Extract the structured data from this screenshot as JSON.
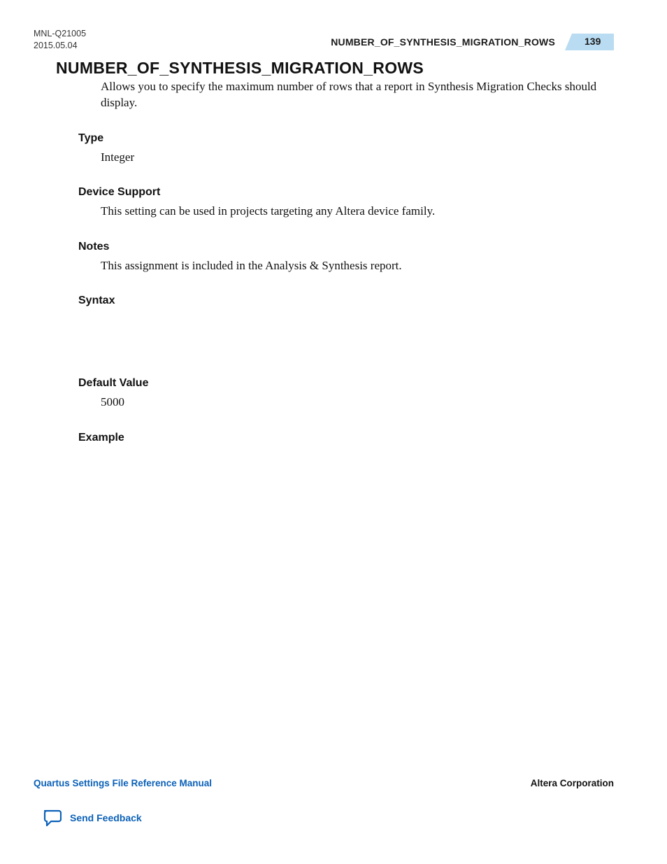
{
  "header": {
    "doc_id": "MNL-Q21005",
    "doc_date": "2015.05.04",
    "topic_title": "NUMBER_OF_SYNTHESIS_MIGRATION_ROWS",
    "page_number": "139"
  },
  "section": {
    "title": "NUMBER_OF_SYNTHESIS_MIGRATION_ROWS",
    "intro": "Allows you to specify the maximum number of rows that a report in Synthesis Migration Checks should display.",
    "type_h": "Type",
    "type_body": "Integer",
    "device_h": "Device Support",
    "device_body": "This setting can be used in projects targeting any Altera device family.",
    "notes_h": "Notes",
    "notes_body": "This assignment is included in the Analysis & Synthesis report.",
    "syntax_h": "Syntax",
    "default_h": "Default Value",
    "default_body": "5000",
    "example_h": "Example"
  },
  "footer": {
    "manual_name": "Quartus Settings File Reference Manual",
    "company": "Altera Corporation",
    "feedback": "Send Feedback"
  },
  "colors": {
    "link_blue": "#0b61b8",
    "badge_blue": "#b9dcf2"
  }
}
